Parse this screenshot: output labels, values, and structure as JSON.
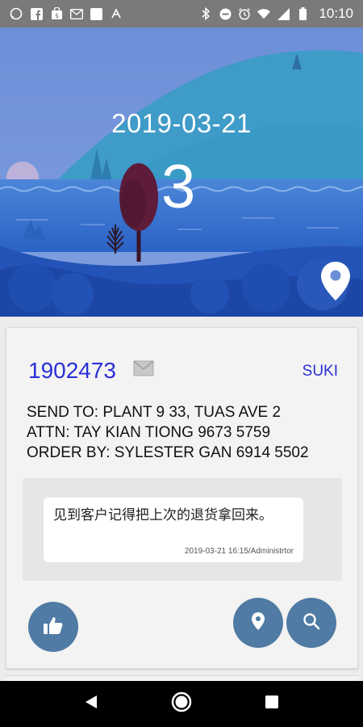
{
  "status_bar": {
    "time": "10:10",
    "left_icons": [
      "whatsapp-icon",
      "facebook-icon",
      "shopping-bag-icon",
      "gmail-icon",
      "square-app-icon",
      "arrow-app-icon"
    ],
    "right_icons": [
      "bluetooth-icon",
      "do-not-disturb-icon",
      "alarm-icon",
      "wifi-icon",
      "signal-icon",
      "battery-icon"
    ]
  },
  "header": {
    "date": "2019-03-21",
    "count": "3"
  },
  "order": {
    "number": "1902473",
    "assignee": "SUKI",
    "details": " SEND TO: PLANT 9 33, TUAS AVE 2\nATTN: TAY KIAN TIONG 9673 5759\nORDER BY: SYLESTER GAN 6914 5502",
    "note": {
      "text": "见到客户记得把上次的退货拿回来。",
      "meta": "2019-03-21 16:15/Administrtor"
    }
  },
  "actions": [
    "thumbs-up-icon",
    "location-pin-icon",
    "search-icon"
  ],
  "colors": {
    "accent": "#2b2fd6",
    "fab": "#4f7ba4",
    "sky": "#6b8fd6",
    "hill": "#3a9ac9",
    "water": "#2f6fd0"
  }
}
